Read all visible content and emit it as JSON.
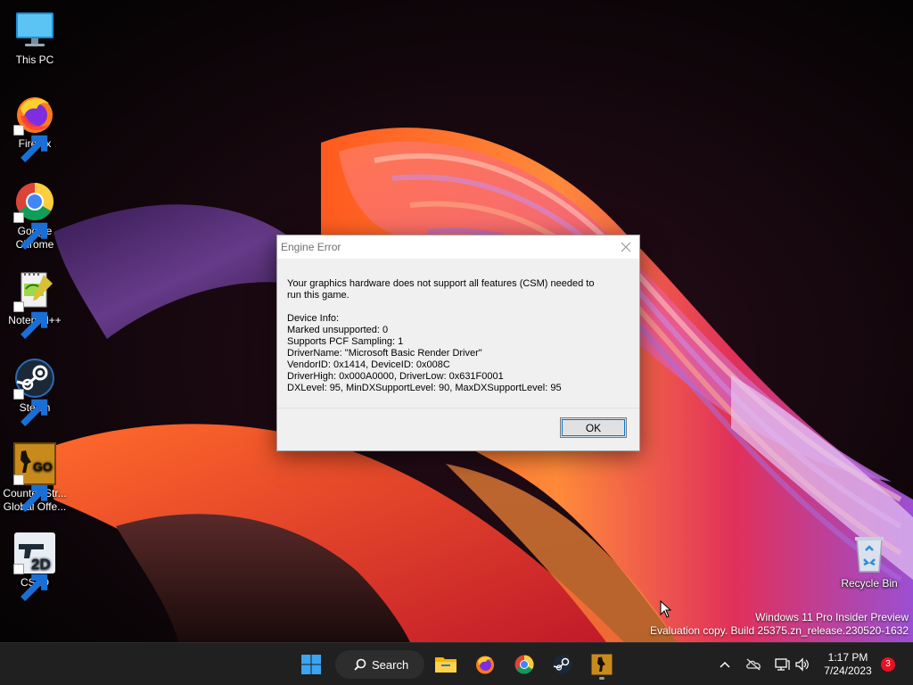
{
  "desktop": {
    "icons": [
      {
        "label_1": "This PC",
        "label_2": "",
        "icon": "monitor-icon"
      },
      {
        "label_1": "Firefox",
        "label_2": "",
        "icon": "firefox-icon"
      },
      {
        "label_1": "Google",
        "label_2": "Chrome",
        "icon": "chrome-icon"
      },
      {
        "label_1": "Notepad++",
        "label_2": "",
        "icon": "notepadpp-icon"
      },
      {
        "label_1": "Steam",
        "label_2": "",
        "icon": "steam-icon"
      },
      {
        "label_1": "Counter-Str...",
        "label_2": "Global Offe...",
        "icon": "csgo-icon"
      },
      {
        "label_1": "CS2D",
        "label_2": "",
        "icon": "cs2d-icon"
      },
      {
        "label_1": "Recycle Bin",
        "label_2": "",
        "icon": "recycle-bin-icon"
      }
    ],
    "watermark": {
      "line1": "Windows 11 Pro Insider Preview",
      "line2": "Evaluation copy. Build 25375.zn_release.230520-1632"
    }
  },
  "dialog": {
    "title": "Engine Error",
    "message_line1": "Your graphics hardware does not support all features (CSM) needed to",
    "message_line2": "run this game.",
    "details": [
      "Device Info:",
      "Marked unsupported: 0",
      "Supports PCF Sampling: 1",
      "DriverName: \"Microsoft Basic Render Driver\"",
      "VendorID: 0x1414, DeviceID: 0x008C",
      "DriverHigh: 0x000A0000, DriverLow: 0x631F0001",
      "DXLevel: 95, MinDXSupportLevel: 90, MaxDXSupportLevel: 95"
    ],
    "ok_label": "OK",
    "close_icon": "close-icon"
  },
  "taskbar": {
    "search_label": "Search",
    "pinned": [
      "start-icon",
      "file-explorer-icon",
      "firefox-icon",
      "chrome-icon",
      "steam-icon",
      "csgo-icon"
    ],
    "tray": [
      "chevron-up-icon",
      "onedrive-icon",
      "network-icon",
      "volume-icon"
    ],
    "clock_time": "1:17 PM",
    "clock_date": "7/24/2023",
    "notification_count": "3"
  },
  "colors": {
    "taskbar_bg": "#202020",
    "dialog_bg": "#f0f0f0",
    "accent": "#0078d7",
    "badge": "#e81123"
  }
}
